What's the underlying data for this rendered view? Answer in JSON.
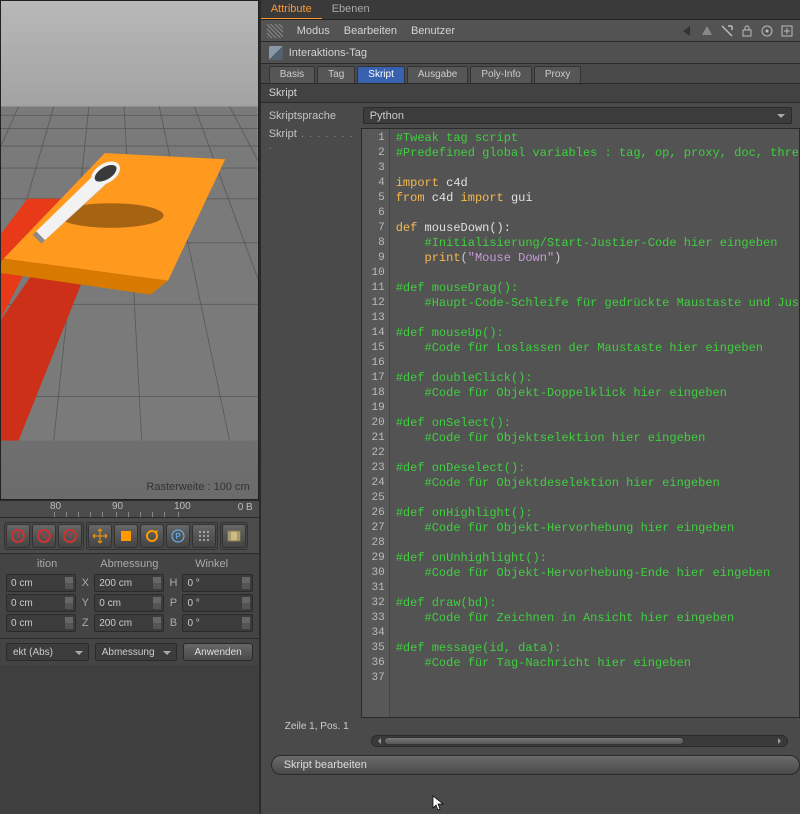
{
  "tabs": {
    "attribute": "Attribute",
    "layers": "Ebenen"
  },
  "menubar": {
    "modus": "Modus",
    "bearbeiten": "Bearbeiten",
    "benutzer": "Benutzer"
  },
  "tag": {
    "name": "Interaktions-Tag"
  },
  "subtabs": {
    "basis": "Basis",
    "tag": "Tag",
    "skript": "Skript",
    "ausgabe": "Ausgabe",
    "polyinfo": "Poly-Info",
    "proxy": "Proxy"
  },
  "section": "Skript",
  "lang": {
    "label": "Skriptsprache",
    "value": "Python"
  },
  "script_label": "Skript",
  "status": "Zeile 1, Pos. 1",
  "edit_btn": "Skript bearbeiten",
  "viewport": {
    "grid_label": "Rasterweite : 100 cm"
  },
  "ruler": {
    "t80": "80",
    "t90": "90",
    "t100": "100",
    "zero": "0 B"
  },
  "coords": {
    "head": {
      "pos": "ition",
      "size": "Abmessung",
      "ang": "Winkel"
    },
    "rows": [
      {
        "p": "0 cm",
        "px": "X",
        "s": "200 cm",
        "sx": "H",
        "a": "0 °"
      },
      {
        "p": "0 cm",
        "px": "Y",
        "s": "0 cm",
        "sx": "P",
        "a": "0 °"
      },
      {
        "p": "0 cm",
        "px": "Z",
        "s": "200 cm",
        "sx": "B",
        "a": "0 °"
      }
    ],
    "combos": {
      "obj": "ekt (Abs)",
      "dim": "Abmessung"
    },
    "apply": "Anwenden"
  },
  "script_code": {
    "l1": "#Tweak tag script",
    "l2": "#Predefined global variables : tag, op, proxy, doc, thre",
    "l4_kw": "import",
    "l4_id": " c4d",
    "l5_kw1": "from",
    "l5_id1": " c4d ",
    "l5_kw2": "import",
    "l5_id2": " gui",
    "l7_kw": "def",
    "l7_fn": " mouseDown():",
    "l8": "    ",
    "l8c": "#Initialisierung/Start-Justier-Code hier eingeben",
    "l9": "    ",
    "l9kw": "print",
    "l9p1": "(",
    "l9s": "\"Mouse Down\"",
    "l9p2": ")",
    "l11": "#def mouseDrag():",
    "l12": "    ",
    "l12c": "#Haupt-Code-Schleife für gedrückte Maustaste und Jus",
    "l14": "#def mouseUp():",
    "l15": "    ",
    "l15c": "#Code für Loslassen der Maustaste hier eingeben",
    "l17": "#def doubleClick():",
    "l18": "    ",
    "l18c": "#Code für Objekt-Doppelklick hier eingeben",
    "l20": "#def onSelect():",
    "l21": "    ",
    "l21c": "#Code für Objektselektion hier eingeben",
    "l23": "#def onDeselect():",
    "l24": "    ",
    "l24c": "#Code für Objektdeselektion hier eingeben",
    "l26": "#def onHighlight():",
    "l27": "    ",
    "l27c": "#Code für Objekt-Hervorhebung hier eingeben",
    "l29": "#def onUnhighlight():",
    "l30": "    ",
    "l30c": "#Code für Objekt-Hervorhebung-Ende hier eingeben",
    "l32": "#def draw(bd):",
    "l33": "    ",
    "l33c": "#Code für Zeichnen in Ansicht hier eingeben",
    "l35": "#def message(id, data):",
    "l36": "    ",
    "l36c": "#Code für Tag-Nachricht hier eingeben"
  }
}
